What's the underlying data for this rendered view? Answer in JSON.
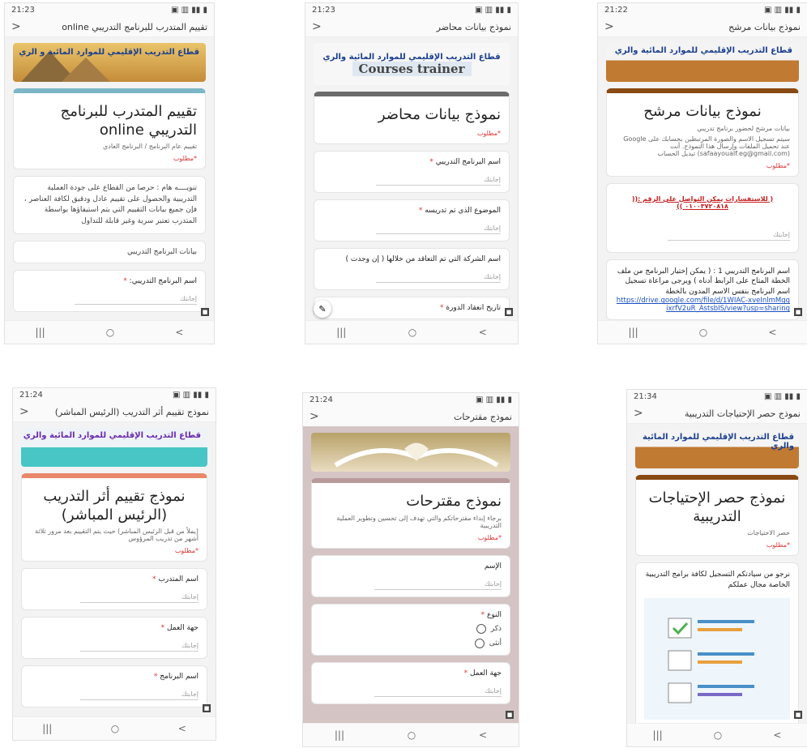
{
  "phones": [
    {
      "status_time": "21:23",
      "title": "تقييم المتدرب للبرنامج التدريبي online",
      "banner": "قطاع التدريب الإقليمي للموارد المائية و الري",
      "form_title": "تقييم المتدرب للبرنامج التدريبي online",
      "form_subtitle": "تقييم عام البرنامج / البرنامج العادي",
      "required": "*مطلوب",
      "note": "تنويــــه هام : حرصا من القطاع على جودة العملية التدريبية والحصول على تقييم عادل ودقيق لكافة العناصر ، فإن جميع بيانات التقييم التي يتم استيفاؤها بواسطة المتدرب تعتبر سرية وغير قابلة للتداول",
      "section": "بيانات البرنامج التدريبي",
      "question": "اسم البرنامج التدريبي:",
      "answer_placeholder": "إجابتك"
    },
    {
      "status_time": "21:23",
      "title": "نموذج بيانات محاضر",
      "banner": "قطاع التدريب الإقليمي للموارد المائية والري",
      "banner_sub": "Courses trainer",
      "form_title": "نموذج بيانات محاضر",
      "required": "*مطلوب",
      "q1": "اسم البرنامج التدريبي",
      "q2": "الموضوع الذي تم تدريسه",
      "q3": "اسم الشركة التي تم التعاقد من خلالها ( إن وجدت )",
      "q4": "تاريخ انعقاد الدورة",
      "answer_placeholder": "إجابتك"
    },
    {
      "status_time": "21:22",
      "title": "نموذج بيانات مرشح",
      "banner": "قطاع التدريب الإقليمي للموارد المائية والري",
      "form_title": "نموذج بيانات مرشح",
      "form_subtitle": "بيانات مرشح لحضور برنامج تدريبي",
      "google_note": "سيتم تسجيل الاسم والصورة المرتبطين بحسابك على Google عند تحميل الملفات وإرسال هذا النموذج. أنت (safaayoualf.eg@gmail.com) تبديل الحساب",
      "required": "*مطلوب",
      "inquiry": "( للاستفسارات يمكن التواصل على الرقم :(( ٠١٠٠٣٧٢٠٨١٨ ))",
      "q1": "اسم البرنامج التدريبي 1 : ( يمكن إختيار البرنامج من ملف الخطة المتاح على الرابط أدناه ) ويرجى مراعاة تسجيل اسم البرنامج بنفس الاسم المدون بالخطة",
      "link": "https://drive.google.com/file/d/1WIAC-xveInlmMggixrfV2uR_AstsbIS/view?usp=sharing",
      "answer_placeholder": "إجابتك"
    },
    {
      "status_time": "21:24",
      "title": "نموذج تقييم أثر التدريب (الرئيس المباشر)",
      "banner": "قطاع التدريب الإقليمي للموارد المائية والري",
      "form_title": "نموذج تقييم أثر التدريب (الرئيس المباشر)",
      "form_subtitle": "(يملأ من قبل الرئيس المباشر) حيث يتم التقييم بعد مرور ثلاثة أشهر من تدريب المرؤوس",
      "required": "*مطلوب",
      "q1": "اسم المتدرب",
      "q2": "جهة العمل",
      "q3": "اسم البرنامج",
      "answer_placeholder": "إجابتك"
    },
    {
      "status_time": "21:24",
      "title": "نموذج مقترحات",
      "form_title": "نموذج مقترحات",
      "form_subtitle": "برجاء إبداء مقترحاتكم والتي تهدف إلى تحسين وتطوير العملية التدريبية",
      "required": "*مطلوب",
      "q1": "الإسم",
      "q2": "النوع",
      "opt1": "ذكر",
      "opt2": "أنثى",
      "q3": "جهة العمل",
      "answer_placeholder": "إجابتك"
    },
    {
      "status_time": "21:34",
      "title": "نموذج حصر الإحتياجات التدريبية",
      "banner": "قطاع التدريب الإقليمي للموارد المائية والري",
      "form_title": "نموذج حصر الإحتياجات التدريبية",
      "form_subtitle": "حصر الاحتياجات",
      "required": "*مطلوب",
      "note": "نرجو من سيادتكم التسجيل لكافة برامج التدريبية الخاصة مجال عملكم"
    }
  ],
  "nav": {
    "recent": "|||",
    "home": "○",
    "back": "<"
  },
  "status_icons": "⊠ ✉ ◀ ···",
  "status_right": "▣ ▥ ▮▮ ▮"
}
